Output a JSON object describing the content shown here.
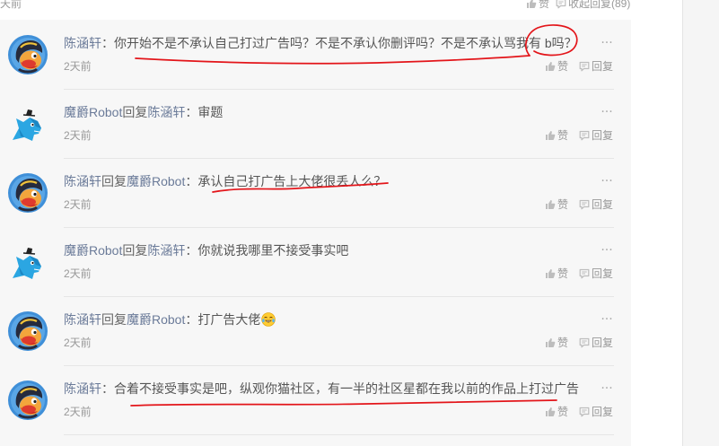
{
  "top_row": {
    "time": "天前",
    "like_label": "赞",
    "collapse_label": "收起回复(89)"
  },
  "actions": {
    "like_label": "赞",
    "reply_label": "回复",
    "more_label": "···"
  },
  "replies": [
    {
      "avatar": "monkey-avatar",
      "author": "陈涵轩",
      "reply_word": "",
      "target": "",
      "colon": "：",
      "text": "你开始不是不承认自己打过广告吗？不是不承认你删评吗？不是不承认骂我有 b吗？",
      "time": "2天前"
    },
    {
      "avatar": "robot-fox-avatar",
      "author": "魔爵Robot",
      "reply_word": "回复",
      "target": "陈涵轩",
      "colon": "：",
      "text": "审题",
      "time": "2天前"
    },
    {
      "avatar": "monkey-avatar",
      "author": "陈涵轩",
      "reply_word": "回复",
      "target": "魔爵Robot",
      "colon": "：",
      "text": "承认自己打广告上大佬很丢人么？",
      "time": "2天前"
    },
    {
      "avatar": "robot-fox-avatar",
      "author": "魔爵Robot",
      "reply_word": "回复",
      "target": "陈涵轩",
      "colon": "：",
      "text": "你就说我哪里不接受事实吧",
      "time": "2天前"
    },
    {
      "avatar": "monkey-avatar",
      "author": "陈涵轩",
      "reply_word": "回复",
      "target": "魔爵Robot",
      "colon": "：",
      "text": "打广告大佬",
      "emoji": "face-with-tears-of-joy",
      "time": "2天前"
    },
    {
      "avatar": "monkey-avatar",
      "author": "陈涵轩",
      "reply_word": "",
      "target": "",
      "colon": "：",
      "text": "合着不接受事实是吧，纵观你猫社区，有一半的社区星都在我以前的作品上打过广告",
      "time": "2天前"
    }
  ],
  "colors": {
    "author_link": "#6b7b99",
    "content_text": "#555555",
    "muted_text": "#999999",
    "panel_background": "#f7f7f7",
    "annotation_red": "#e3151a"
  }
}
